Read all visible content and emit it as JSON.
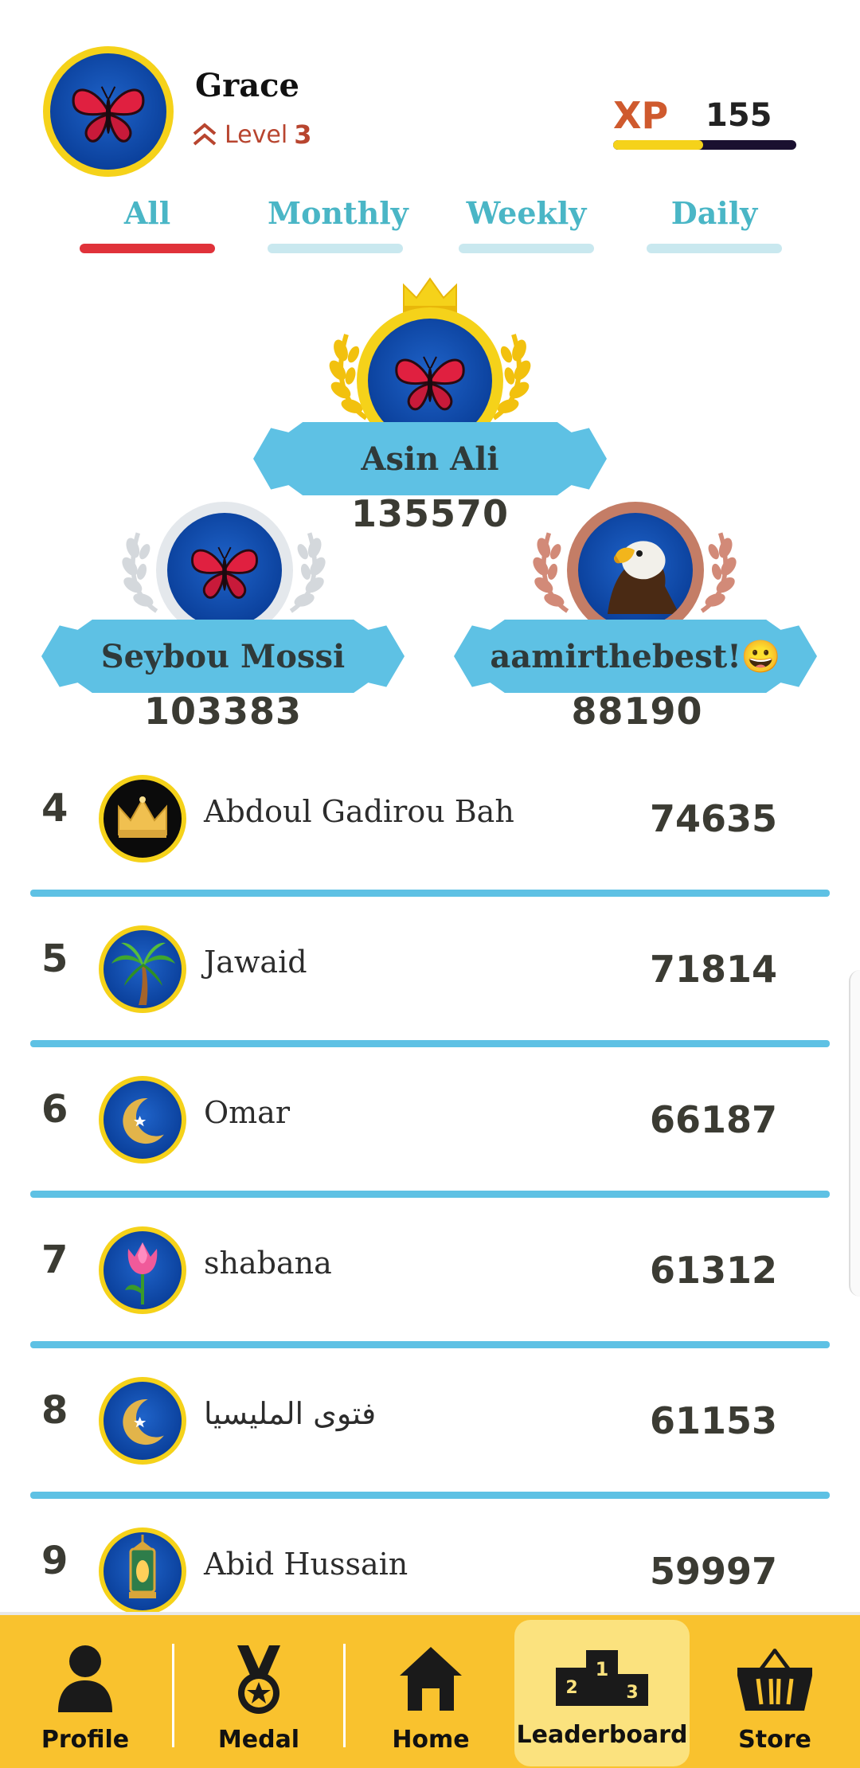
{
  "header": {
    "username": "Grace",
    "level_label": "Level",
    "level_value": "3",
    "xp_label": "XP",
    "xp_value": "155",
    "xp_progress": 0.49
  },
  "tabs": [
    {
      "label": "All",
      "active": true
    },
    {
      "label": "Monthly",
      "active": false
    },
    {
      "label": "Weekly",
      "active": false
    },
    {
      "label": "Daily",
      "active": false
    }
  ],
  "podium": {
    "first": {
      "name": "Asin Ali",
      "score": "135570",
      "avatar": "butterfly-icon"
    },
    "second": {
      "name": "Seybou Mossi",
      "score": "103383",
      "avatar": "butterfly-icon"
    },
    "third": {
      "name": "aamirthebest!😀",
      "score": "88190",
      "avatar": "eagle-icon"
    }
  },
  "leaderboard": [
    {
      "rank": "4",
      "name": "Abdoul Gadirou Bah",
      "score": "74635",
      "avatar": "crown-icon"
    },
    {
      "rank": "5",
      "name": "Jawaid",
      "score": "71814",
      "avatar": "palm-tree-icon"
    },
    {
      "rank": "6",
      "name": "Omar",
      "score": "66187",
      "avatar": "crescent-icon"
    },
    {
      "rank": "7",
      "name": "shabana",
      "score": "61312",
      "avatar": "tulip-icon"
    },
    {
      "rank": "8",
      "name": "فتوى المليسيا",
      "score": "61153",
      "avatar": "crescent-icon"
    },
    {
      "rank": "9",
      "name": "Abid Hussain",
      "score": "59997",
      "avatar": "lantern-icon"
    }
  ],
  "nav": [
    {
      "label": "Profile",
      "icon": "person-icon",
      "active": false
    },
    {
      "label": "Medal",
      "icon": "medal-icon",
      "active": false
    },
    {
      "label": "Home",
      "icon": "home-icon",
      "active": false
    },
    {
      "label": "Leaderboard",
      "icon": "podium-icon",
      "active": true
    },
    {
      "label": "Store",
      "icon": "basket-icon",
      "active": false
    }
  ],
  "colors": {
    "accent_yellow": "#f9c22e",
    "ribbon_blue": "#5ec1e4",
    "tab_text": "#4ab6c6",
    "active_tab_bar": "#e0323a",
    "level_orange": "#b8452f"
  }
}
